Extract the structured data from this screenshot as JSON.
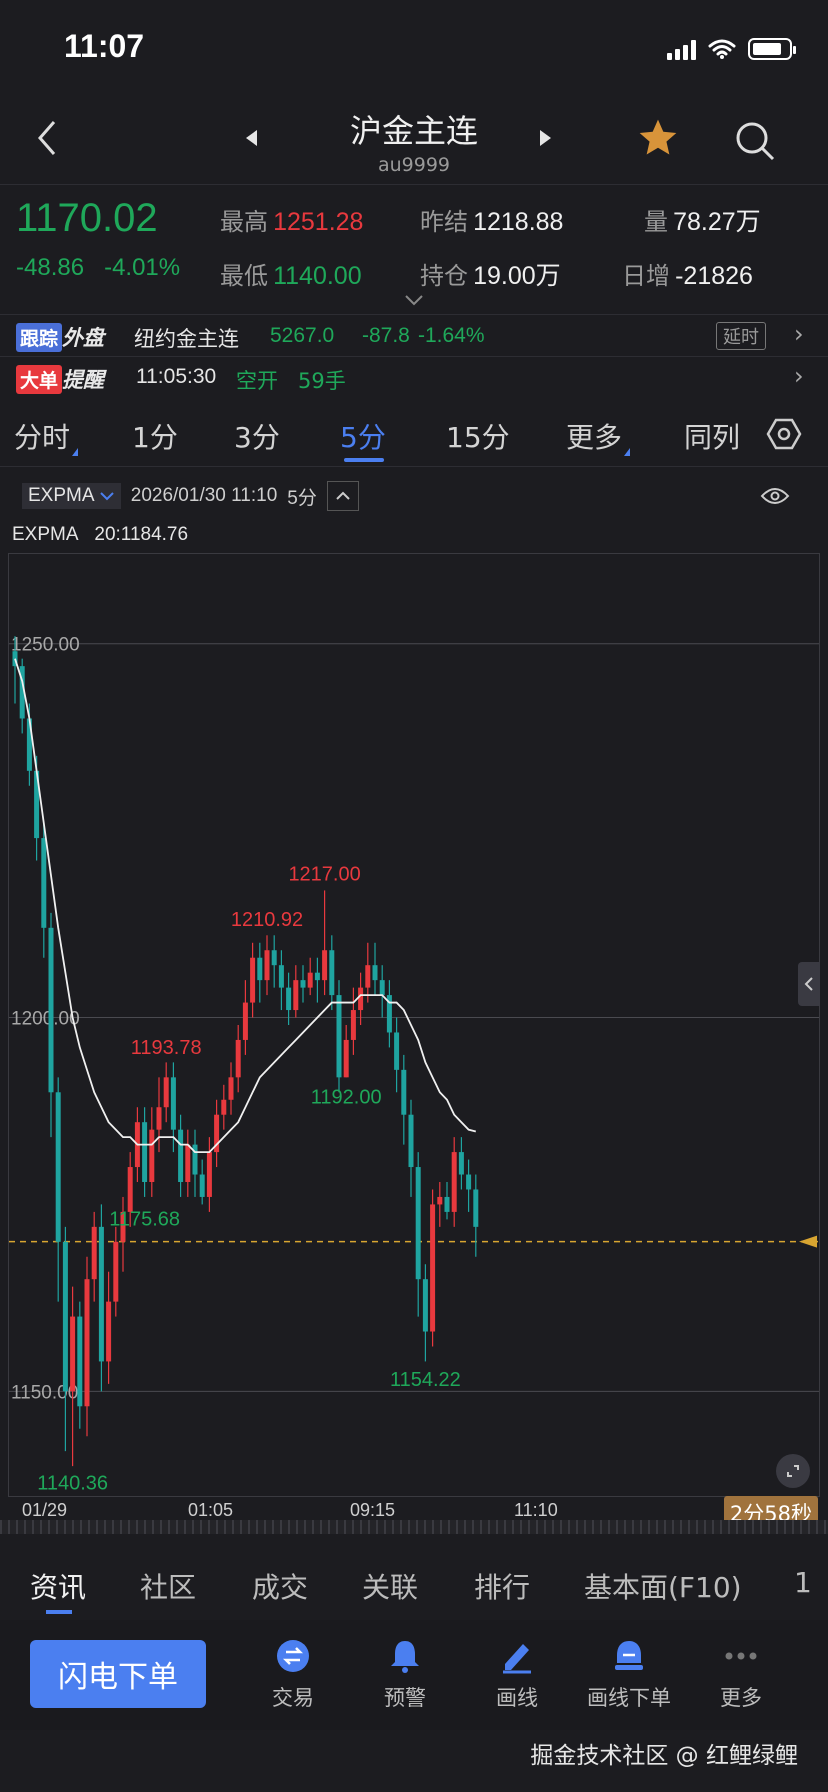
{
  "status_bar": {
    "time": "11:07"
  },
  "header": {
    "title": "沪金主连",
    "subtitle": "au9999",
    "back_icon": "chevron-left-icon",
    "favorite_icon": "star-icon",
    "search_icon": "search-icon",
    "favorite_color": "#d8943a"
  },
  "quote": {
    "price": "1170.02",
    "change": "-48.86",
    "change_pct": "-4.01%",
    "high_label": "最高",
    "high": "1251.28",
    "low_label": "最低",
    "low": "1140.00",
    "prev_settle_label": "昨结",
    "prev_settle": "1218.88",
    "open_interest_label": "持仓",
    "open_interest": "19.00万",
    "volume_label": "量",
    "volume": "78.27万",
    "daily_inc_label": "日增",
    "daily_inc": "-21826",
    "up_color": "#e8393e",
    "down_color": "#1fa85a"
  },
  "tracking": {
    "tag_a": "跟踪",
    "tag_b": "外盘",
    "name": "纽约金主连",
    "price": "5267.0",
    "change": "-87.8",
    "change_pct": "-1.64%",
    "badge": "延时"
  },
  "big_order": {
    "tag_a": "大单",
    "tag_b": "提醒",
    "time": "11:05:30",
    "action": "空开",
    "qty": "59手"
  },
  "period_tabs": [
    {
      "label": "分时",
      "active": false
    },
    {
      "label": "1分",
      "active": false
    },
    {
      "label": "3分",
      "active": false
    },
    {
      "label": "5分",
      "active": true
    },
    {
      "label": "15分",
      "active": false
    },
    {
      "label": "更多",
      "active": false
    },
    {
      "label": "同列",
      "active": false
    }
  ],
  "indicator": {
    "name": "EXPMA",
    "datetime": "2026/01/30 11:10",
    "period": "5分",
    "legend_name": "EXPMA",
    "legend_value": "20:1184.76"
  },
  "chart_data": {
    "type": "candlestick",
    "y_ticks": [
      "1250.00",
      "1200.00",
      "1150.00"
    ],
    "ylim": [
      1136,
      1262
    ],
    "x_ticks": [
      "01/29",
      "01:05",
      "09:15",
      "11:10"
    ],
    "current_price": 1170.02,
    "annotations": [
      {
        "label": "1217.00",
        "value": 1217.0,
        "kind": "high"
      },
      {
        "label": "1210.92",
        "value": 1210.92,
        "kind": "high"
      },
      {
        "label": "1193.78",
        "value": 1193.78,
        "kind": "high"
      },
      {
        "label": "1192.00",
        "value": 1192.0,
        "kind": "low"
      },
      {
        "label": "1175.68",
        "value": 1175.68,
        "kind": "low"
      },
      {
        "label": "1154.22",
        "value": 1154.22,
        "kind": "low"
      },
      {
        "label": "1140.36",
        "value": 1140.36,
        "kind": "low"
      }
    ],
    "candles": [
      [
        1249,
        1247,
        1251,
        1242
      ],
      [
        1247,
        1240,
        1248,
        1238
      ],
      [
        1240,
        1233,
        1242,
        1231
      ],
      [
        1233,
        1224,
        1235,
        1221
      ],
      [
        1224,
        1212,
        1226,
        1208
      ],
      [
        1212,
        1190,
        1214,
        1184
      ],
      [
        1190,
        1170,
        1192,
        1162
      ],
      [
        1170,
        1150,
        1172,
        1142
      ],
      [
        1150,
        1160,
        1164,
        1140
      ],
      [
        1160,
        1148,
        1162,
        1145
      ],
      [
        1148,
        1165,
        1168,
        1144
      ],
      [
        1165,
        1172,
        1174,
        1162
      ],
      [
        1172,
        1154,
        1175,
        1150
      ],
      [
        1154,
        1162,
        1166,
        1151
      ],
      [
        1162,
        1170,
        1172,
        1160
      ],
      [
        1170,
        1174,
        1176,
        1166
      ],
      [
        1174,
        1180,
        1182,
        1172
      ],
      [
        1180,
        1186,
        1188,
        1178
      ],
      [
        1186,
        1178,
        1188,
        1176
      ],
      [
        1178,
        1185,
        1188,
        1176
      ],
      [
        1185,
        1188,
        1192,
        1182
      ],
      [
        1188,
        1192,
        1194,
        1186
      ],
      [
        1192,
        1185,
        1194,
        1182
      ],
      [
        1185,
        1178,
        1187,
        1176
      ],
      [
        1178,
        1183,
        1185,
        1176
      ],
      [
        1183,
        1179,
        1185,
        1176
      ],
      [
        1179,
        1176,
        1181,
        1175
      ],
      [
        1176,
        1182,
        1184,
        1174
      ],
      [
        1182,
        1187,
        1189,
        1180
      ],
      [
        1187,
        1189,
        1191,
        1185
      ],
      [
        1189,
        1192,
        1194,
        1187
      ],
      [
        1192,
        1197,
        1199,
        1190
      ],
      [
        1197,
        1202,
        1205,
        1195
      ],
      [
        1202,
        1208,
        1210,
        1200
      ],
      [
        1208,
        1205,
        1210,
        1202
      ],
      [
        1205,
        1209,
        1211,
        1203
      ],
      [
        1209,
        1207,
        1211,
        1204
      ],
      [
        1207,
        1204,
        1209,
        1201
      ],
      [
        1204,
        1201,
        1206,
        1199
      ],
      [
        1201,
        1205,
        1207,
        1200
      ],
      [
        1205,
        1204,
        1207,
        1202
      ],
      [
        1204,
        1206,
        1208,
        1203
      ],
      [
        1206,
        1205,
        1208,
        1202
      ],
      [
        1205,
        1209,
        1217,
        1203
      ],
      [
        1209,
        1203,
        1211,
        1201
      ],
      [
        1203,
        1192,
        1205,
        1190
      ],
      [
        1192,
        1197,
        1199,
        1192
      ],
      [
        1197,
        1201,
        1204,
        1195
      ],
      [
        1201,
        1204,
        1206,
        1199
      ],
      [
        1204,
        1207,
        1210,
        1202
      ],
      [
        1207,
        1205,
        1210,
        1203
      ],
      [
        1205,
        1203,
        1207,
        1200
      ],
      [
        1203,
        1198,
        1205,
        1196
      ],
      [
        1198,
        1193,
        1200,
        1190
      ],
      [
        1193,
        1187,
        1195,
        1183
      ],
      [
        1187,
        1180,
        1189,
        1176
      ],
      [
        1180,
        1165,
        1182,
        1160
      ],
      [
        1165,
        1158,
        1167,
        1154
      ],
      [
        1158,
        1175,
        1177,
        1156
      ],
      [
        1175,
        1176,
        1178,
        1172
      ],
      [
        1176,
        1174,
        1178,
        1173
      ],
      [
        1174,
        1182,
        1184,
        1172
      ],
      [
        1182,
        1179,
        1184,
        1177
      ],
      [
        1179,
        1177,
        1181,
        1174
      ],
      [
        1177,
        1172,
        1179,
        1168
      ]
    ],
    "expma": [
      1248,
      1245,
      1240,
      1233,
      1226,
      1219,
      1212,
      1206,
      1200,
      1196,
      1193,
      1190,
      1188,
      1186,
      1185,
      1184,
      1184,
      1183,
      1183,
      1183,
      1184,
      1184,
      1184,
      1183,
      1183,
      1182,
      1182,
      1182,
      1183,
      1184,
      1185,
      1186,
      1188,
      1190,
      1192,
      1193,
      1194,
      1195,
      1196,
      1197,
      1198,
      1199,
      1200,
      1201,
      1202,
      1202,
      1202,
      1202,
      1203,
      1203,
      1203,
      1203,
      1202,
      1202,
      1201,
      1199,
      1197,
      1194,
      1192,
      1190,
      1189,
      1187,
      1186,
      1185,
      1184.76
    ],
    "up_color": "#e8393e",
    "down_color": "#1fa4a0",
    "ma_color": "#f0f0f0",
    "price_line_color": "#d8a531"
  },
  "countdown": "2分58秒",
  "bottom_tabs": [
    "资讯",
    "社区",
    "成交",
    "关联",
    "排行",
    "基本面(F10)",
    "1"
  ],
  "actions": {
    "flash_order": "闪电下单",
    "items": [
      {
        "label": "交易",
        "icon": "trade-icon"
      },
      {
        "label": "预警",
        "icon": "bell-icon"
      },
      {
        "label": "画线",
        "icon": "draw-line-icon"
      },
      {
        "label": "画线下单",
        "icon": "draw-order-icon"
      },
      {
        "label": "更多",
        "icon": "more-icon"
      }
    ]
  },
  "watermark": "掘金技术社区 @ 红鲤绿鲤"
}
